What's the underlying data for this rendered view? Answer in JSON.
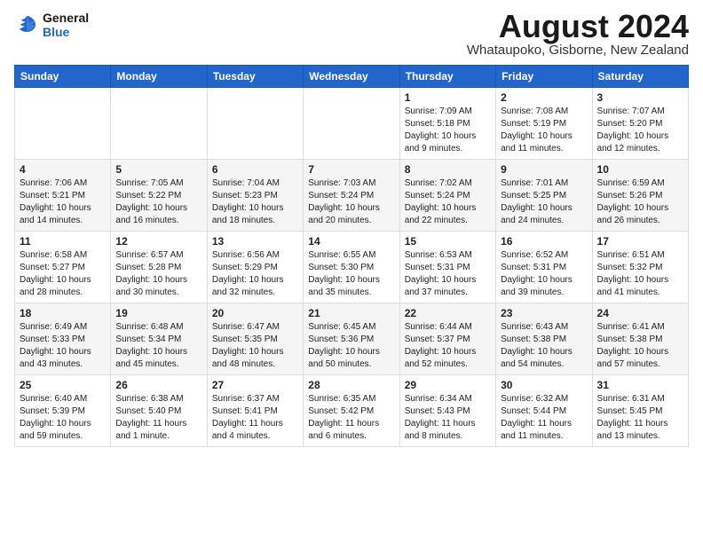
{
  "header": {
    "logo_line1": "General",
    "logo_line2": "Blue",
    "month_year": "August 2024",
    "location": "Whataupoko, Gisborne, New Zealand"
  },
  "weekdays": [
    "Sunday",
    "Monday",
    "Tuesday",
    "Wednesday",
    "Thursday",
    "Friday",
    "Saturday"
  ],
  "weeks": [
    [
      {
        "day": "",
        "info": ""
      },
      {
        "day": "",
        "info": ""
      },
      {
        "day": "",
        "info": ""
      },
      {
        "day": "",
        "info": ""
      },
      {
        "day": "1",
        "info": "Sunrise: 7:09 AM\nSunset: 5:18 PM\nDaylight: 10 hours\nand 9 minutes."
      },
      {
        "day": "2",
        "info": "Sunrise: 7:08 AM\nSunset: 5:19 PM\nDaylight: 10 hours\nand 11 minutes."
      },
      {
        "day": "3",
        "info": "Sunrise: 7:07 AM\nSunset: 5:20 PM\nDaylight: 10 hours\nand 12 minutes."
      }
    ],
    [
      {
        "day": "4",
        "info": "Sunrise: 7:06 AM\nSunset: 5:21 PM\nDaylight: 10 hours\nand 14 minutes."
      },
      {
        "day": "5",
        "info": "Sunrise: 7:05 AM\nSunset: 5:22 PM\nDaylight: 10 hours\nand 16 minutes."
      },
      {
        "day": "6",
        "info": "Sunrise: 7:04 AM\nSunset: 5:23 PM\nDaylight: 10 hours\nand 18 minutes."
      },
      {
        "day": "7",
        "info": "Sunrise: 7:03 AM\nSunset: 5:24 PM\nDaylight: 10 hours\nand 20 minutes."
      },
      {
        "day": "8",
        "info": "Sunrise: 7:02 AM\nSunset: 5:24 PM\nDaylight: 10 hours\nand 22 minutes."
      },
      {
        "day": "9",
        "info": "Sunrise: 7:01 AM\nSunset: 5:25 PM\nDaylight: 10 hours\nand 24 minutes."
      },
      {
        "day": "10",
        "info": "Sunrise: 6:59 AM\nSunset: 5:26 PM\nDaylight: 10 hours\nand 26 minutes."
      }
    ],
    [
      {
        "day": "11",
        "info": "Sunrise: 6:58 AM\nSunset: 5:27 PM\nDaylight: 10 hours\nand 28 minutes."
      },
      {
        "day": "12",
        "info": "Sunrise: 6:57 AM\nSunset: 5:28 PM\nDaylight: 10 hours\nand 30 minutes."
      },
      {
        "day": "13",
        "info": "Sunrise: 6:56 AM\nSunset: 5:29 PM\nDaylight: 10 hours\nand 32 minutes."
      },
      {
        "day": "14",
        "info": "Sunrise: 6:55 AM\nSunset: 5:30 PM\nDaylight: 10 hours\nand 35 minutes."
      },
      {
        "day": "15",
        "info": "Sunrise: 6:53 AM\nSunset: 5:31 PM\nDaylight: 10 hours\nand 37 minutes."
      },
      {
        "day": "16",
        "info": "Sunrise: 6:52 AM\nSunset: 5:31 PM\nDaylight: 10 hours\nand 39 minutes."
      },
      {
        "day": "17",
        "info": "Sunrise: 6:51 AM\nSunset: 5:32 PM\nDaylight: 10 hours\nand 41 minutes."
      }
    ],
    [
      {
        "day": "18",
        "info": "Sunrise: 6:49 AM\nSunset: 5:33 PM\nDaylight: 10 hours\nand 43 minutes."
      },
      {
        "day": "19",
        "info": "Sunrise: 6:48 AM\nSunset: 5:34 PM\nDaylight: 10 hours\nand 45 minutes."
      },
      {
        "day": "20",
        "info": "Sunrise: 6:47 AM\nSunset: 5:35 PM\nDaylight: 10 hours\nand 48 minutes."
      },
      {
        "day": "21",
        "info": "Sunrise: 6:45 AM\nSunset: 5:36 PM\nDaylight: 10 hours\nand 50 minutes."
      },
      {
        "day": "22",
        "info": "Sunrise: 6:44 AM\nSunset: 5:37 PM\nDaylight: 10 hours\nand 52 minutes."
      },
      {
        "day": "23",
        "info": "Sunrise: 6:43 AM\nSunset: 5:38 PM\nDaylight: 10 hours\nand 54 minutes."
      },
      {
        "day": "24",
        "info": "Sunrise: 6:41 AM\nSunset: 5:38 PM\nDaylight: 10 hours\nand 57 minutes."
      }
    ],
    [
      {
        "day": "25",
        "info": "Sunrise: 6:40 AM\nSunset: 5:39 PM\nDaylight: 10 hours\nand 59 minutes."
      },
      {
        "day": "26",
        "info": "Sunrise: 6:38 AM\nSunset: 5:40 PM\nDaylight: 11 hours\nand 1 minute."
      },
      {
        "day": "27",
        "info": "Sunrise: 6:37 AM\nSunset: 5:41 PM\nDaylight: 11 hours\nand 4 minutes."
      },
      {
        "day": "28",
        "info": "Sunrise: 6:35 AM\nSunset: 5:42 PM\nDaylight: 11 hours\nand 6 minutes."
      },
      {
        "day": "29",
        "info": "Sunrise: 6:34 AM\nSunset: 5:43 PM\nDaylight: 11 hours\nand 8 minutes."
      },
      {
        "day": "30",
        "info": "Sunrise: 6:32 AM\nSunset: 5:44 PM\nDaylight: 11 hours\nand 11 minutes."
      },
      {
        "day": "31",
        "info": "Sunrise: 6:31 AM\nSunset: 5:45 PM\nDaylight: 11 hours\nand 13 minutes."
      }
    ]
  ]
}
